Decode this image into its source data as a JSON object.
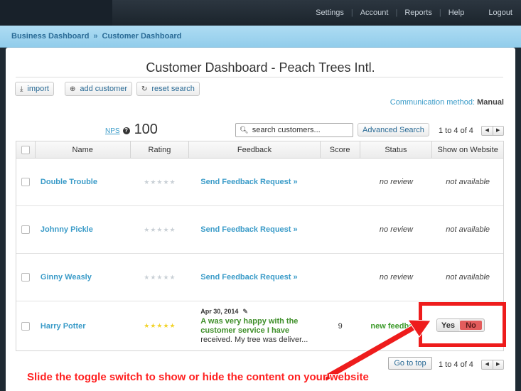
{
  "topnav": {
    "items": [
      "Settings",
      "Account",
      "Reports",
      "Help"
    ],
    "logout": "Logout"
  },
  "breadcrumb": {
    "items": [
      "Business Dashboard",
      "Customer Dashboard"
    ],
    "separator": "»"
  },
  "page": {
    "title": "Customer Dashboard - Peach Trees Intl."
  },
  "toolbar": {
    "import_label": "import",
    "add_customer_label": "add customer",
    "reset_search_label": "reset search"
  },
  "communication": {
    "label": "Communication method:",
    "value": "Manual"
  },
  "nps": {
    "label": "NPS",
    "value": "100"
  },
  "search": {
    "placeholder": "search customers...",
    "advanced_label": "Advanced Search"
  },
  "pager": {
    "text_top": "1 to 4 of 4",
    "text_bottom": "1 to 4 of 4"
  },
  "table": {
    "columns": [
      "Name",
      "Rating",
      "Feedback",
      "Score",
      "Status",
      "Show on Website"
    ],
    "rows": [
      {
        "name": "Double Trouble",
        "feedback": "Send Feedback Request »",
        "score": "",
        "status": "no review",
        "website": "not available"
      },
      {
        "name": "Johnny Pickle",
        "feedback": "Send Feedback Request »",
        "score": "",
        "status": "no review",
        "website": "not available"
      },
      {
        "name": "Ginny Weasly",
        "feedback": "Send Feedback Request »",
        "score": "",
        "status": "no review",
        "website": "not available"
      },
      {
        "name": "Harry Potter",
        "feedback_date": "Apr 30, 2014",
        "feedback_bold": "A was very happy with the customer service I have",
        "feedback_rest": "received. My tree was deliver...",
        "score": "9",
        "status": "new feedback"
      }
    ],
    "stars_empty": "★★★★★",
    "stars_full": "★★★★★"
  },
  "toggle": {
    "yes": "Yes",
    "no": "No"
  },
  "footer": {
    "go_to_top": "Go to top"
  },
  "annotation": {
    "caption": "Slide the toggle switch to show or hide the content on your website",
    "color": "#ee1c1c"
  },
  "colors": {
    "link": "#3a9bc8",
    "positive": "#3f9c2d",
    "no_toggle": "#e35c5c"
  }
}
